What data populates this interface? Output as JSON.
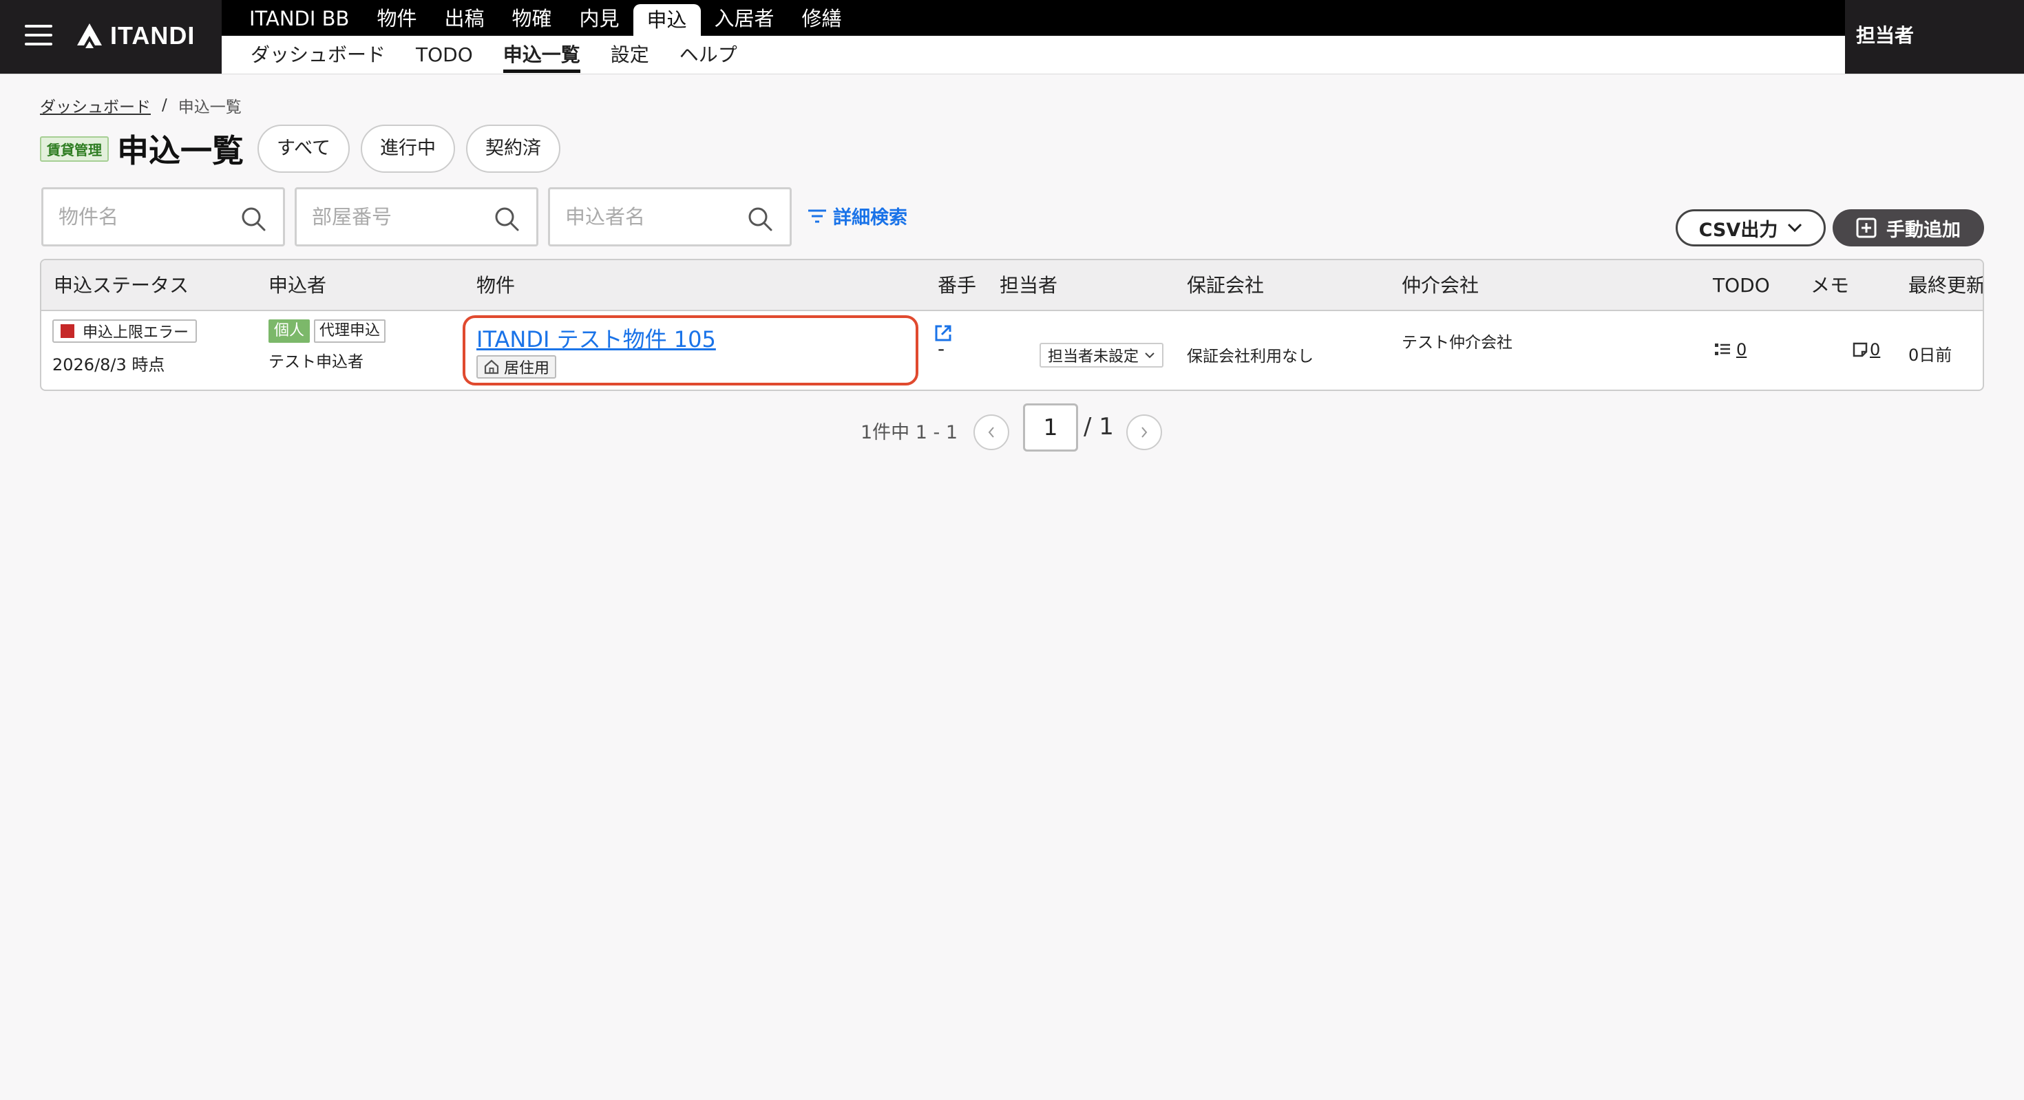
{
  "app": {
    "logo_text": "ITANDI",
    "user_label": "担当者"
  },
  "nav": {
    "main_tabs": [
      "ITANDI BB",
      "物件",
      "出稿",
      "物確",
      "内見",
      "申込",
      "入居者",
      "修繕"
    ],
    "active_main": "申込",
    "sub_tabs": [
      "ダッシュボード",
      "TODO",
      "申込一覧",
      "設定",
      "ヘルプ"
    ],
    "active_sub": "申込一覧"
  },
  "breadcrumb": {
    "root": "ダッシュボード",
    "separator": "/",
    "current": "申込一覧"
  },
  "header": {
    "badge": "賃貸管理",
    "title": "申込一覧",
    "filters": [
      "すべて",
      "進行中",
      "契約済"
    ]
  },
  "search": {
    "property_placeholder": "物件名",
    "room_placeholder": "部屋番号",
    "applicant_placeholder": "申込者名",
    "detail_label": "詳細検索"
  },
  "actions": {
    "csv_label": "CSV出力",
    "add_label": "手動追加"
  },
  "table": {
    "columns": {
      "status": "申込ステータス",
      "applicant": "申込者",
      "property": "物件",
      "number": "番手",
      "assignee": "担当者",
      "guarantor": "保証会社",
      "broker": "仲介会社",
      "todo": "TODO",
      "memo": "メモ",
      "updated": "最終更新"
    },
    "rows": [
      {
        "status": "申込上限エラー",
        "status_date": "2026/8/3 時点",
        "applicant_type": "個人",
        "applicant_proxy": "代理申込",
        "applicant_name": "テスト申込者",
        "property_name": "ITANDI テスト物件 105",
        "property_use": "居住用",
        "number": "-",
        "assignee": "担当者未設定",
        "guarantor": "保証会社利用なし",
        "broker": "テスト仲介会社",
        "todo_count": "0",
        "memo_count": "0",
        "updated": "0日前"
      }
    ]
  },
  "pagination": {
    "info": "1件中 1 - 1",
    "current": "1",
    "total": "/ 1"
  },
  "colors": {
    "accent_link": "#1a73e8",
    "error_red": "#c62828",
    "highlight_border": "#e04a2f",
    "badge_green": "#7cb86a"
  }
}
